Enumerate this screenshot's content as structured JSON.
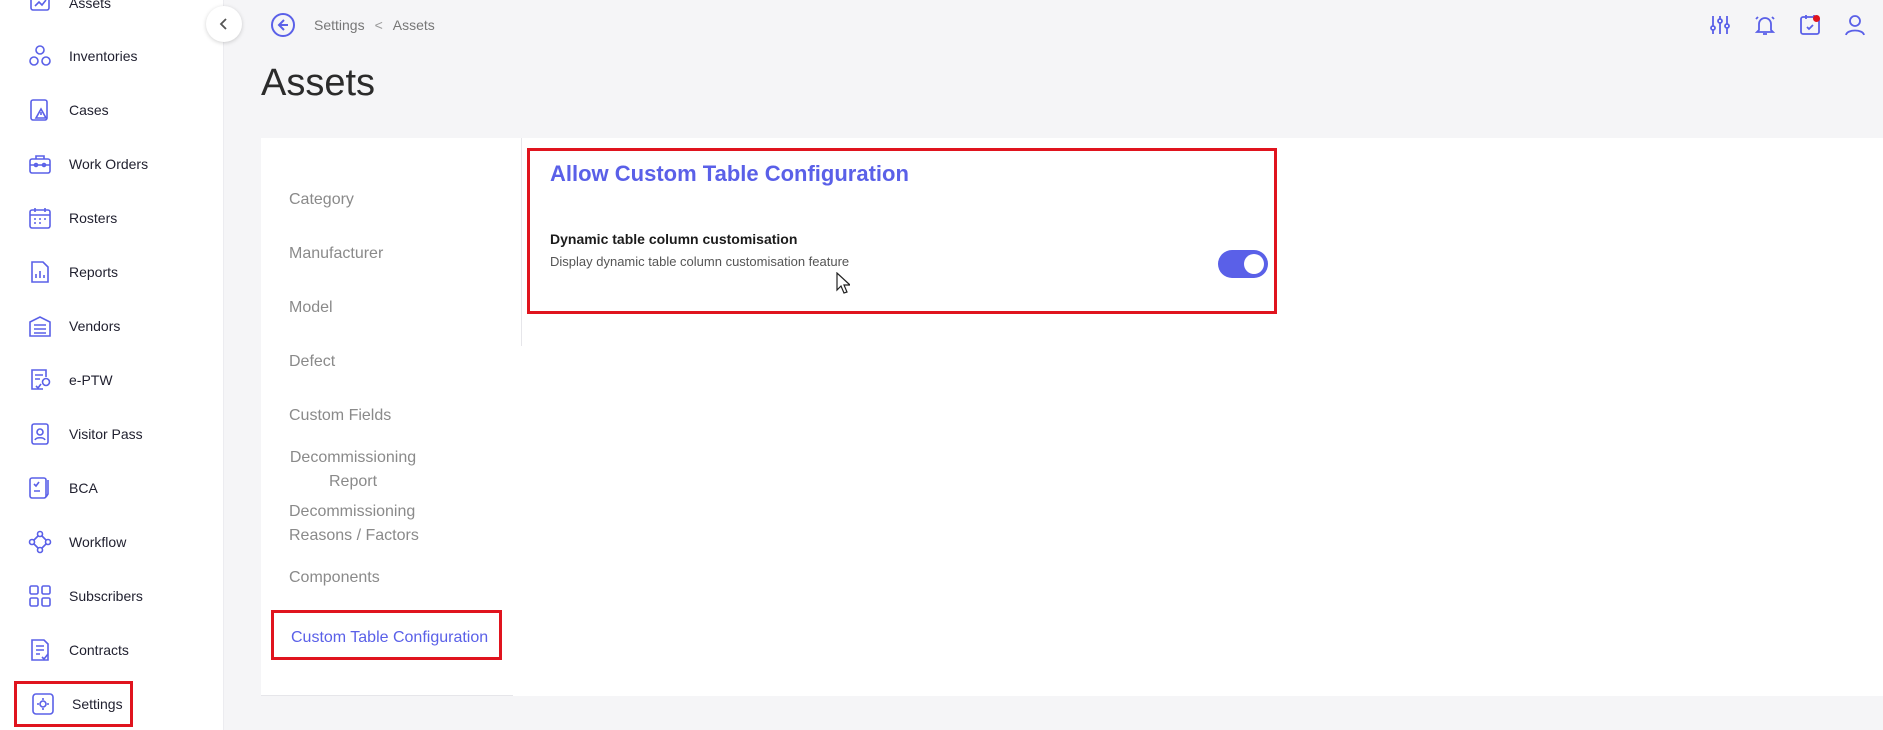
{
  "sidebar": {
    "items": [
      {
        "label": "Assets",
        "icon": "assets-icon"
      },
      {
        "label": "Inventories",
        "icon": "inventories-icon"
      },
      {
        "label": "Cases",
        "icon": "cases-icon"
      },
      {
        "label": "Work Orders",
        "icon": "work-orders-icon"
      },
      {
        "label": "Rosters",
        "icon": "rosters-icon"
      },
      {
        "label": "Reports",
        "icon": "reports-icon"
      },
      {
        "label": "Vendors",
        "icon": "vendors-icon"
      },
      {
        "label": "e-PTW",
        "icon": "eptw-icon"
      },
      {
        "label": "Visitor Pass",
        "icon": "visitor-pass-icon"
      },
      {
        "label": "BCA",
        "icon": "bca-icon"
      },
      {
        "label": "Workflow",
        "icon": "workflow-icon"
      },
      {
        "label": "Subscribers",
        "icon": "subscribers-icon"
      },
      {
        "label": "Contracts",
        "icon": "contracts-icon"
      },
      {
        "label": "Settings",
        "icon": "settings-icon"
      }
    ]
  },
  "breadcrumb": {
    "items": [
      "Settings",
      "Assets"
    ]
  },
  "page": {
    "title": "Assets"
  },
  "subnav": {
    "items": [
      {
        "label": "Category"
      },
      {
        "label": "Manufacturer"
      },
      {
        "label": "Model"
      },
      {
        "label": "Defect"
      },
      {
        "label": "Custom Fields"
      },
      {
        "label": "Decommissioning Report"
      },
      {
        "label": "Decommissioning Reasons / Factors"
      },
      {
        "label": "Components"
      },
      {
        "label": "Custom Table Configuration"
      }
    ],
    "active": "Custom Table Configuration"
  },
  "config": {
    "title": "Allow Custom Table Configuration",
    "setting_title": "Dynamic table column customisation",
    "setting_desc": "Display dynamic table column customisation feature",
    "toggle_on": true
  },
  "colors": {
    "accent": "#5a60e8",
    "highlight": "#e0141e",
    "icon": "#5a60e8"
  }
}
